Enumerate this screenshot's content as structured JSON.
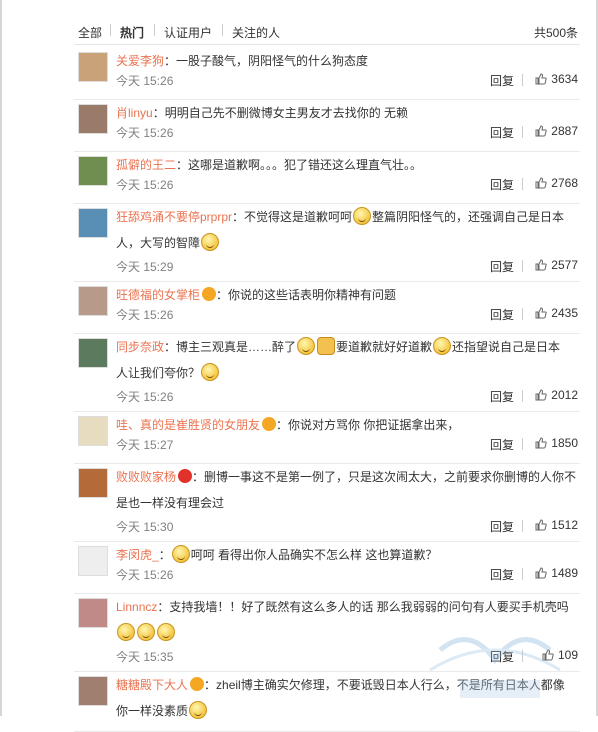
{
  "tabs": {
    "all": "全部",
    "hot": "热门",
    "verified": "认证用户",
    "following": "关注的人",
    "count": "共500条"
  },
  "labels": {
    "reply": "回复"
  },
  "comments": [
    {
      "user": "关爱李狗",
      "badge": "",
      "parts": [
        {
          "t": "：一股子酸气，阴阳怪气的什么狗态度"
        }
      ],
      "time": "今天 15:26",
      "likes": "3634",
      "avatar_color": "#c9a27a"
    },
    {
      "user": "肖linyu",
      "badge": "",
      "parts": [
        {
          "t": "：明明自己先不删微博女主男友才去找你的 无赖"
        }
      ],
      "time": "今天 15:26",
      "likes": "2887",
      "avatar_color": "#9a7b6a"
    },
    {
      "user": "孤僻的王二",
      "badge": "",
      "parts": [
        {
          "t": "：这哪是道歉啊。。。犯了错还这么理直气壮。。"
        }
      ],
      "time": "今天 15:26",
      "likes": "2768",
      "avatar_color": "#6f8e4f"
    },
    {
      "user": "狂舔鸡涌不要停prprpr",
      "badge": "",
      "line1": [
        {
          "t": "：不觉得这是道歉呵呵"
        },
        {
          "e": "smiley"
        },
        {
          "t": "整篇阴阳怪气的，还强调自己是日本"
        }
      ],
      "line2": [
        {
          "t": "人，大写的智障"
        },
        {
          "e": "smiley"
        }
      ],
      "time": "今天 15:29",
      "likes": "2577",
      "avatar_color": "#5a8fb5"
    },
    {
      "user": "旺德福的女掌柜",
      "badge": "orange",
      "parts": [
        {
          "t": "：你说的这些话表明你精神有问题"
        }
      ],
      "time": "今天 15:26",
      "likes": "2435",
      "avatar_color": "#b89a8a"
    },
    {
      "user": "同步奈政",
      "badge": "",
      "line1": [
        {
          "t": "：博主三观真是……醉了"
        },
        {
          "e": "smiley"
        },
        {
          "e": "cat"
        },
        {
          "t": "要道歉就好好道歉"
        },
        {
          "e": "smiley"
        },
        {
          "t": "还指望说自己是日本"
        }
      ],
      "line2": [
        {
          "t": "人让我们夸你？"
        },
        {
          "e": "smiley"
        }
      ],
      "time": "今天 15:26",
      "likes": "2012",
      "avatar_color": "#5b7a5e"
    },
    {
      "user": "哇、真的是崔胜贤的女朋友",
      "badge": "orange",
      "parts": [
        {
          "t": "：你说对方骂你 你把证据拿出来，"
        }
      ],
      "time": "今天 15:27",
      "likes": "1850",
      "avatar_color": "#e8dcc0"
    },
    {
      "user": "败败败家杨",
      "badge": "red",
      "line1": [
        {
          "t": "：删博一事这不是第一例了，只是这次闹太大，之前要求你删博的人你不"
        }
      ],
      "line2": [
        {
          "t": "是也一样没有理会过"
        }
      ],
      "time": "今天 15:30",
      "likes": "1512",
      "avatar_color": "#b56a3a"
    },
    {
      "user": "李闵虎_",
      "badge": "",
      "parts": [
        {
          "t": "："
        },
        {
          "e": "smiley"
        },
        {
          "t": "呵呵 看得出你人品确实不怎么样 这也算道歉？"
        }
      ],
      "time": "今天 15:26",
      "likes": "1489",
      "avatar_color": "#eeeeee"
    },
    {
      "user": "Linnncz",
      "badge": "",
      "line1": [
        {
          "t": "：支持我墙！！好了既然有这么多人的话 那么我弱弱的问句有人要买手机壳吗"
        }
      ],
      "line2": [
        {
          "e": "smiley"
        },
        {
          "e": "smiley"
        },
        {
          "e": "smiley"
        }
      ],
      "time": "今天 15:35",
      "likes": "109",
      "avatar_color": "#c08a88"
    },
    {
      "user": "糖糖殿下大人",
      "badge": "orange",
      "line1": [
        {
          "t": "：zheil博主确实欠修理，不要诋毁日本人行么，不是所有日本人都像"
        }
      ],
      "line2": [
        {
          "t": "你一样没素质"
        },
        {
          "e": "smiley"
        }
      ],
      "time": "",
      "likes": "",
      "avatar_color": "#a07e70"
    }
  ]
}
